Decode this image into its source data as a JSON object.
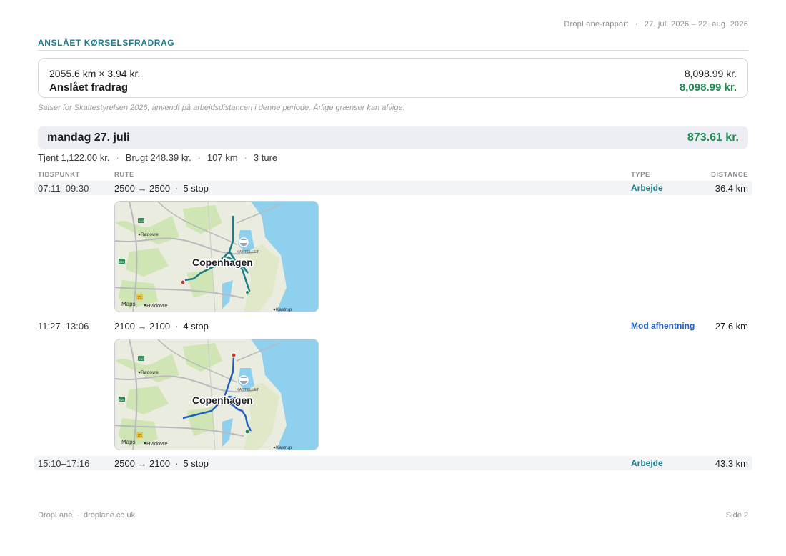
{
  "header": {
    "report_title": "DropLane-rapport",
    "period": "27. jul. 2026 – 22. aug. 2026"
  },
  "section": {
    "title": "ANSLÅET KØRSELSFRADRAG"
  },
  "summary": {
    "calc_label": "2055.6 km × 3.94 kr.",
    "calc_value": "8,098.99 kr.",
    "deduction_label": "Anslået fradrag",
    "deduction_value": "8,098.99 kr.",
    "note": "Satser for Skattestyrelsen 2026, anvendt på arbejdsdistancen i denne periode. Årlige grænser kan afvige."
  },
  "day": {
    "title": "mandag 27. juli",
    "total": "873.61 kr.",
    "stats": [
      "Tjent 1,122.00 kr.",
      "Brugt 248.39 kr.",
      "107 km",
      "3 ture"
    ]
  },
  "columns": {
    "time": "TIDSPUNKT",
    "route": "RUTE",
    "type": "TYPE",
    "distance": "DISTANCE"
  },
  "trips": [
    {
      "time": "07:11–09:30",
      "route": "2500 → 2500",
      "stops": "5 stop",
      "type": "Arbejde",
      "distance": "36.4 km",
      "has_map": true
    },
    {
      "time": "11:27–13:06",
      "route": "2100 → 2100",
      "stops": "4 stop",
      "type": "Mod afhentning",
      "distance": "27.6 km",
      "has_map": true
    },
    {
      "time": "15:10–17:16",
      "route": "2500 → 2100",
      "stops": "5 stop",
      "type": "Arbejde",
      "distance": "43.3 km",
      "has_map": false
    }
  ],
  "map": {
    "city_label": "Copenhagen",
    "places": [
      "Rødovre",
      "Hvidovre",
      "Kastrup",
      "KASTELLET"
    ],
    "road_badges": [
      "E47",
      "E20",
      "21"
    ],
    "attribution": "Maps",
    "route_colors": [
      "#1a7d87",
      "#1f5fbf"
    ]
  },
  "colors": {
    "accent": "#1a7d87",
    "positive": "#1e8a50",
    "type_work": "#1a7d87",
    "type_pickup": "#1f5fbf"
  },
  "footer": {
    "brand": "DropLane",
    "site": "droplane.co.uk",
    "page": "Side 2"
  }
}
